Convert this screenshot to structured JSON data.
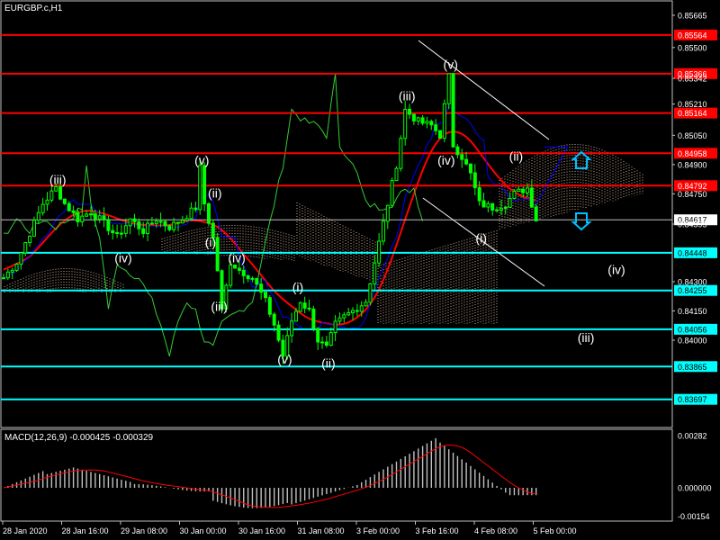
{
  "header": {
    "symbol": "EURGBP.c,H1"
  },
  "macd": {
    "title": "MACD(12,26,9)",
    "value1": "-0.000425",
    "value2": "-0.000329",
    "scale_labels": [
      "0.00282",
      "0.000000",
      "-0.00154"
    ]
  },
  "price_axis": {
    "labels": [
      {
        "text": "0.85665",
        "value": 0.85665
      },
      {
        "text": "0.85500",
        "value": 0.855
      },
      {
        "text": "0.85342",
        "value": 0.85342
      },
      {
        "text": "0.85210",
        "value": 0.8521
      },
      {
        "text": "0.85050",
        "value": 0.8505
      },
      {
        "text": "0.84900",
        "value": 0.849
      },
      {
        "text": "0.84750",
        "value": 0.8475
      },
      {
        "text": "0.84595",
        "value": 0.84595
      },
      {
        "text": "0.84300",
        "value": 0.843
      },
      {
        "text": "0.84150",
        "value": 0.8415
      },
      {
        "text": "0.84000",
        "value": 0.84
      }
    ]
  },
  "levels": [
    {
      "text": "0.85564",
      "value": 0.85564,
      "kind": "red"
    },
    {
      "text": "0.85366",
      "value": 0.85366,
      "kind": "red"
    },
    {
      "text": "0.85164",
      "value": 0.85164,
      "kind": "red"
    },
    {
      "text": "0.84958",
      "value": 0.84958,
      "kind": "red"
    },
    {
      "text": "0.84792",
      "value": 0.84792,
      "kind": "red"
    },
    {
      "text": "0.84617",
      "value": 0.84617,
      "kind": "current"
    },
    {
      "text": "0.84448",
      "value": 0.84448,
      "kind": "cyan"
    },
    {
      "text": "0.84255",
      "value": 0.84255,
      "kind": "cyan"
    },
    {
      "text": "0.84056",
      "value": 0.84056,
      "kind": "cyan"
    },
    {
      "text": "0.83865",
      "value": 0.83865,
      "kind": "cyan"
    },
    {
      "text": "0.83697",
      "value": 0.83697,
      "kind": "cyan"
    }
  ],
  "time_axis": [
    "28 Jan 2020",
    "28 Jan 16:00",
    "29 Jan 08:00",
    "30 Jan 00:00",
    "30 Jan 16:00",
    "31 Jan 08:00",
    "3 Feb 00:00",
    "3 Feb 16:00",
    "4 Feb 08:00",
    "5 Feb 00:00"
  ],
  "wave_labels": [
    {
      "text": "(iii)",
      "anchor": 0.848,
      "bar": 12
    },
    {
      "text": "(v)",
      "anchor": 0.849,
      "bar": 45
    },
    {
      "text": "(ii)",
      "anchor": 0.8473,
      "bar": 48
    },
    {
      "text": "(iv)",
      "anchor": 0.844,
      "bar": 27
    },
    {
      "text": "(i)",
      "anchor": 0.8448,
      "bar": 47
    },
    {
      "text": "(iv)",
      "anchor": 0.844,
      "bar": 53
    },
    {
      "text": "(iii)",
      "anchor": 0.8415,
      "bar": 49
    },
    {
      "text": "(i)",
      "anchor": 0.8425,
      "bar": 67
    },
    {
      "text": "(v)",
      "anchor": 0.8388,
      "bar": 64
    },
    {
      "text": "(ii)",
      "anchor": 0.8386,
      "bar": 74
    },
    {
      "text": "(iii)",
      "anchor": 0.8523,
      "bar": 92
    },
    {
      "text": "(v)",
      "anchor": 0.8539,
      "bar": 102
    },
    {
      "text": "(iv)",
      "anchor": 0.849,
      "bar": 101
    },
    {
      "text": "(ii)",
      "anchor": 0.8492,
      "bar": 117
    },
    {
      "text": "(i)",
      "anchor": 0.845,
      "bar": 109
    },
    {
      "text": "(iv)",
      "anchor": 0.8434,
      "bar": 140
    },
    {
      "text": "(iii)",
      "anchor": 0.8399,
      "bar": 133
    }
  ],
  "colors": {
    "background": "#000000",
    "text": "#ffffff",
    "candle": "#00ff00",
    "red_level": "#ff0000",
    "cyan_level": "#00ffff",
    "current_price": "#c0c0c0",
    "ma_red": "#ff0000",
    "ma_blue": "#0000ff",
    "chikou": "#32cd32",
    "cloud": "#ffdab9",
    "arrow": "#00bfff",
    "macd_hist": "#c0c0c0",
    "macd_signal": "#ff0000"
  },
  "icons": {
    "arrow_up": "arrow-up-icon",
    "arrow_down": "arrow-down-icon"
  },
  "chart_data": {
    "type": "candlestick",
    "title": "EURGBP.c,H1",
    "y_range": [
      0.8359,
      0.857
    ],
    "indicator": "MACD(12,26,9)",
    "macd_current": [
      -0.000425,
      -0.000329
    ],
    "macd_range": [
      -0.00154,
      0.00282
    ]
  }
}
